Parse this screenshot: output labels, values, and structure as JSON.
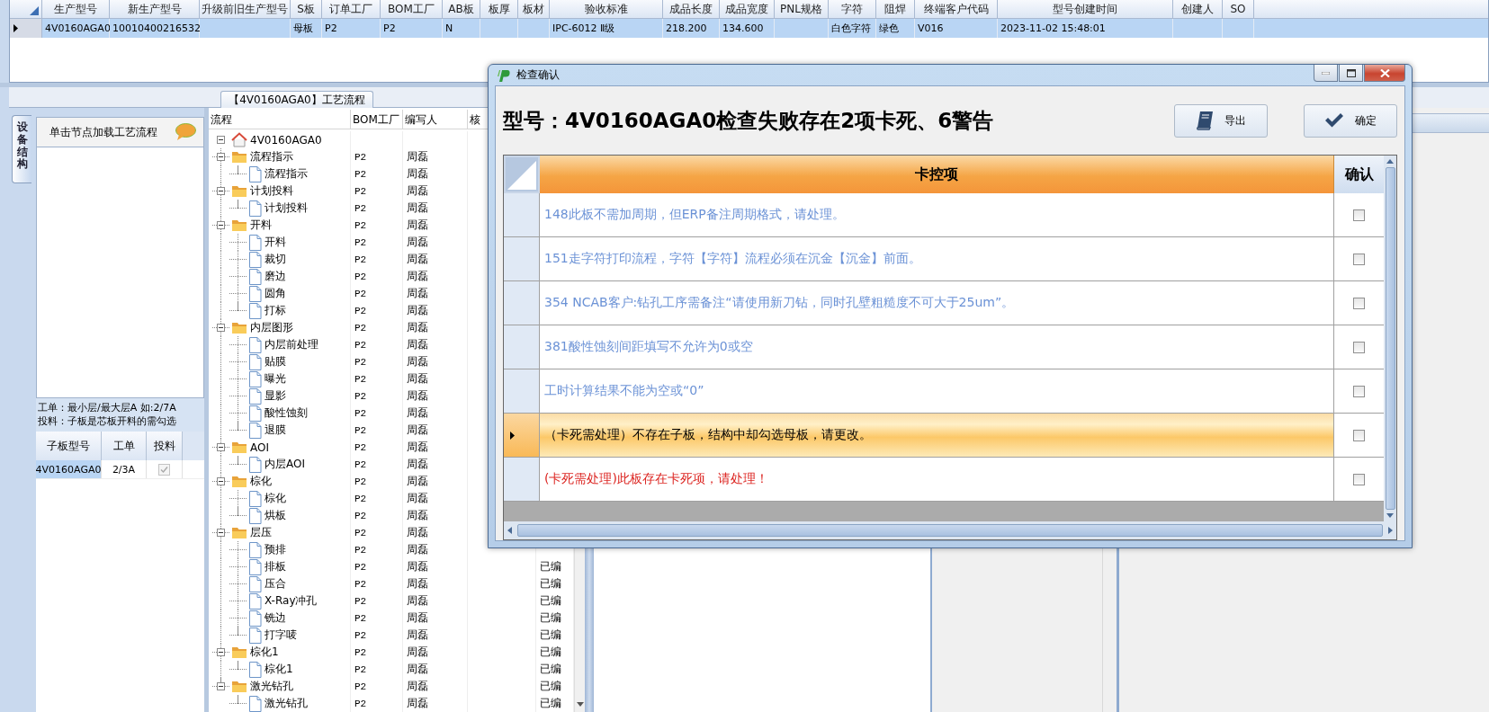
{
  "main_grid": {
    "row_selected": true,
    "columns": [
      {
        "label": "生产型号",
        "value": "4V0160AGA0"
      },
      {
        "label": "新生产型号",
        "value": "10010400216532"
      },
      {
        "label": "升级前旧生产型号"
      },
      {
        "label": "S板",
        "value": "母板"
      },
      {
        "label": "订单工厂",
        "value": "P2"
      },
      {
        "label": "BOM工厂",
        "value": "P2"
      },
      {
        "label": "AB板",
        "value": "N"
      },
      {
        "label": "板厚"
      },
      {
        "label": "板材"
      },
      {
        "label": "验收标准",
        "value": "IPC-6012 Ⅱ级"
      },
      {
        "label": "成品长度",
        "value": "218.200"
      },
      {
        "label": "成品宽度",
        "value": "134.600"
      },
      {
        "label": "PNL规格"
      },
      {
        "label": "字符",
        "value": "白色字符"
      },
      {
        "label": "阻焊",
        "value": "绿色"
      },
      {
        "label": "终端客户代码",
        "value": "V016"
      },
      {
        "label": "型号创建时间",
        "value": "2023-11-02 15:48:01"
      },
      {
        "label": "创建人"
      },
      {
        "label": "SO"
      }
    ]
  },
  "process_tab": {
    "label": "【4V0160AGA0】工艺流程"
  },
  "side_tab": {
    "label": "设备结构",
    "selected": true
  },
  "left_panel": {
    "hint": "单击节点加载工艺流程",
    "notes": [
      "工单：最小层/最大层A 如:2/7A",
      "投料：子板是芯板开料的需勾选"
    ],
    "columns": [
      "子板型号",
      "工单",
      "投料"
    ],
    "rows": [
      {
        "model": "4V0160AGA0",
        "order": "2/3A",
        "feed_checked": true,
        "disabled": true,
        "selected": true
      }
    ]
  },
  "process_tree": {
    "columns": [
      "流程",
      "BOM工厂",
      "编写人",
      "核"
    ],
    "root": {
      "label": "4V0160AGA0",
      "expanded": true,
      "children": [
        {
          "label": "流程指示",
          "bom": "P2",
          "author": "周磊",
          "expanded": true,
          "children": [
            {
              "label": "流程指示",
              "bom": "P2",
              "author": "周磊"
            }
          ]
        },
        {
          "label": "计划投料",
          "bom": "P2",
          "author": "周磊",
          "expanded": true,
          "children": [
            {
              "label": "计划投料",
              "bom": "P2",
              "author": "周磊"
            }
          ]
        },
        {
          "label": "开料",
          "bom": "P2",
          "author": "周磊",
          "expanded": true,
          "children": [
            {
              "label": "开料",
              "bom": "P2",
              "author": "周磊"
            },
            {
              "label": "裁切",
              "bom": "P2",
              "author": "周磊"
            },
            {
              "label": "磨边",
              "bom": "P2",
              "author": "周磊"
            },
            {
              "label": "圆角",
              "bom": "P2",
              "author": "周磊"
            },
            {
              "label": "打标",
              "bom": "P2",
              "author": "周磊"
            }
          ]
        },
        {
          "label": "内层图形",
          "bom": "P2",
          "author": "周磊",
          "expanded": true,
          "children": [
            {
              "label": "内层前处理",
              "bom": "P2",
              "author": "周磊"
            },
            {
              "label": "贴膜",
              "bom": "P2",
              "author": "周磊"
            },
            {
              "label": "曝光",
              "bom": "P2",
              "author": "周磊"
            },
            {
              "label": "显影",
              "bom": "P2",
              "author": "周磊"
            },
            {
              "label": "酸性蚀刻",
              "bom": "P2",
              "author": "周磊"
            },
            {
              "label": "退膜",
              "bom": "P2",
              "author": "周磊"
            }
          ]
        },
        {
          "label": "AOI",
          "bom": "P2",
          "author": "周磊",
          "expanded": true,
          "children": [
            {
              "label": "内层AOI",
              "bom": "P2",
              "author": "周磊"
            }
          ]
        },
        {
          "label": "棕化",
          "bom": "P2",
          "author": "周磊",
          "expanded": true,
          "children": [
            {
              "label": "棕化",
              "bom": "P2",
              "author": "周磊"
            },
            {
              "label": "烘板",
              "bom": "P2",
              "author": "周磊"
            }
          ]
        },
        {
          "label": "层压",
          "bom": "P2",
          "author": "周磊",
          "expanded": true,
          "children": [
            {
              "label": "预排",
              "bom": "P2",
              "author": "周磊"
            },
            {
              "label": "排板",
              "bom": "P2",
              "author": "周磊",
              "status": "已编"
            },
            {
              "label": "压合",
              "bom": "P2",
              "author": "周磊",
              "status": "已编"
            },
            {
              "label": "X-Ray冲孔",
              "bom": "P2",
              "author": "周磊",
              "status": "已编"
            },
            {
              "label": "铣边",
              "bom": "P2",
              "author": "周磊",
              "status": "已编"
            },
            {
              "label": "打字唛",
              "bom": "P2",
              "author": "周磊",
              "status": "已编"
            }
          ]
        },
        {
          "label": "棕化1",
          "bom": "P2",
          "author": "周磊",
          "status": "已编",
          "expanded": true,
          "children": [
            {
              "label": "棕化1",
              "bom": "P2",
              "author": "周磊",
              "status": "已编"
            }
          ]
        },
        {
          "label": "激光钻孔",
          "bom": "P2",
          "author": "周磊",
          "status": "已编",
          "expanded": true,
          "children": [
            {
              "label": "激光钻孔",
              "bom": "P2",
              "author": "周磊",
              "status": "已编"
            }
          ]
        }
      ]
    }
  },
  "dialog": {
    "title": "检查确认",
    "heading": "型号：4V0160AGA0检查失败存在2项卡死、6警告",
    "buttons": [
      {
        "label": "导出",
        "kind": "export"
      },
      {
        "label": "确定",
        "kind": "confirm"
      }
    ],
    "columns": [
      "卡控项",
      "确认"
    ],
    "items": [
      {
        "text": "148此板不需加周期，但ERP备注周期格式，请处理。",
        "kind": "warning",
        "selected": false,
        "checked": false
      },
      {
        "text": "151走字符打印流程，字符【字符】流程必须在沉金【沉金】前面。",
        "kind": "warning",
        "selected": false,
        "checked": false
      },
      {
        "text": "354 NCAB客户:钻孔工序需备注“请使用新刀钻，同时孔壁粗糙度不可大于25um”。",
        "kind": "warning",
        "selected": false,
        "checked": false
      },
      {
        "text": "381酸性蚀刻间距填写不允许为0或空",
        "kind": "warning",
        "selected": false,
        "checked": false
      },
      {
        "text": "工时计算结果不能为空或“0”",
        "kind": "warning",
        "selected": false,
        "checked": false
      },
      {
        "text": "（卡死需处理）不存在子板，结构中却勾选母板，请更改。",
        "kind": "error",
        "selected": true,
        "checked": false
      },
      {
        "text": "(卡死需处理)此板存在卡死项，请处理！",
        "kind": "error",
        "selected": false,
        "checked": false
      }
    ]
  }
}
